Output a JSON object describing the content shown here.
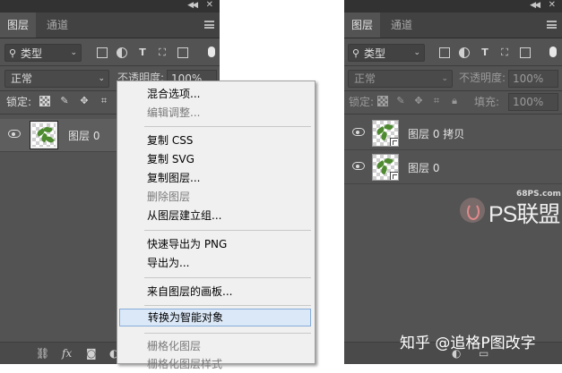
{
  "left_panel": {
    "tabs": [
      "图层",
      "通道"
    ],
    "filter_label": "类型",
    "blend_mode": "正常",
    "opacity_label": "不透明度:",
    "opacity_value": "100%",
    "lock_label": "锁定:",
    "layers": [
      {
        "name": "图层 0",
        "selected": true
      }
    ]
  },
  "context_menu": {
    "items": [
      {
        "label": "混合选项...",
        "disabled": false
      },
      {
        "label": "编辑调整...",
        "disabled": true
      },
      {
        "label": "复制 CSS",
        "disabled": false
      },
      {
        "label": "复制 SVG",
        "disabled": false
      },
      {
        "label": "复制图层...",
        "disabled": false
      },
      {
        "label": "删除图层",
        "disabled": true
      },
      {
        "label": "从图层建立组...",
        "disabled": false
      },
      {
        "label": "快速导出为 PNG",
        "disabled": false
      },
      {
        "label": "导出为...",
        "disabled": false
      },
      {
        "label": "来自图层的画板...",
        "disabled": false
      },
      {
        "label": "转换为智能对象",
        "disabled": false,
        "highlighted": true
      },
      {
        "label": "栅格化图层",
        "disabled": true
      },
      {
        "label": "栅格化图层样式",
        "disabled": true
      }
    ]
  },
  "right_panel": {
    "tabs": [
      "图层",
      "通道"
    ],
    "filter_label": "类型",
    "blend_mode": "正常",
    "opacity_label": "不透明度:",
    "opacity_value": "100%",
    "lock_label": "锁定:",
    "fill_label": "填充:",
    "fill_value": "100%",
    "layers": [
      {
        "name": "图层 0 拷贝",
        "smart_object": true
      },
      {
        "name": "图层 0",
        "smart_object": true
      }
    ]
  },
  "watermark": {
    "site": "68PS.com",
    "logo_text": "PS联盟",
    "zhihu": "知乎 @追格P图改字"
  },
  "colors": {
    "panel_bg": "#535353",
    "tab_bar_bg": "#424242",
    "menu_bg": "#f0f0f0",
    "menu_highlight": "#dbe8f7",
    "leaf_green": "#4e8a2f"
  }
}
